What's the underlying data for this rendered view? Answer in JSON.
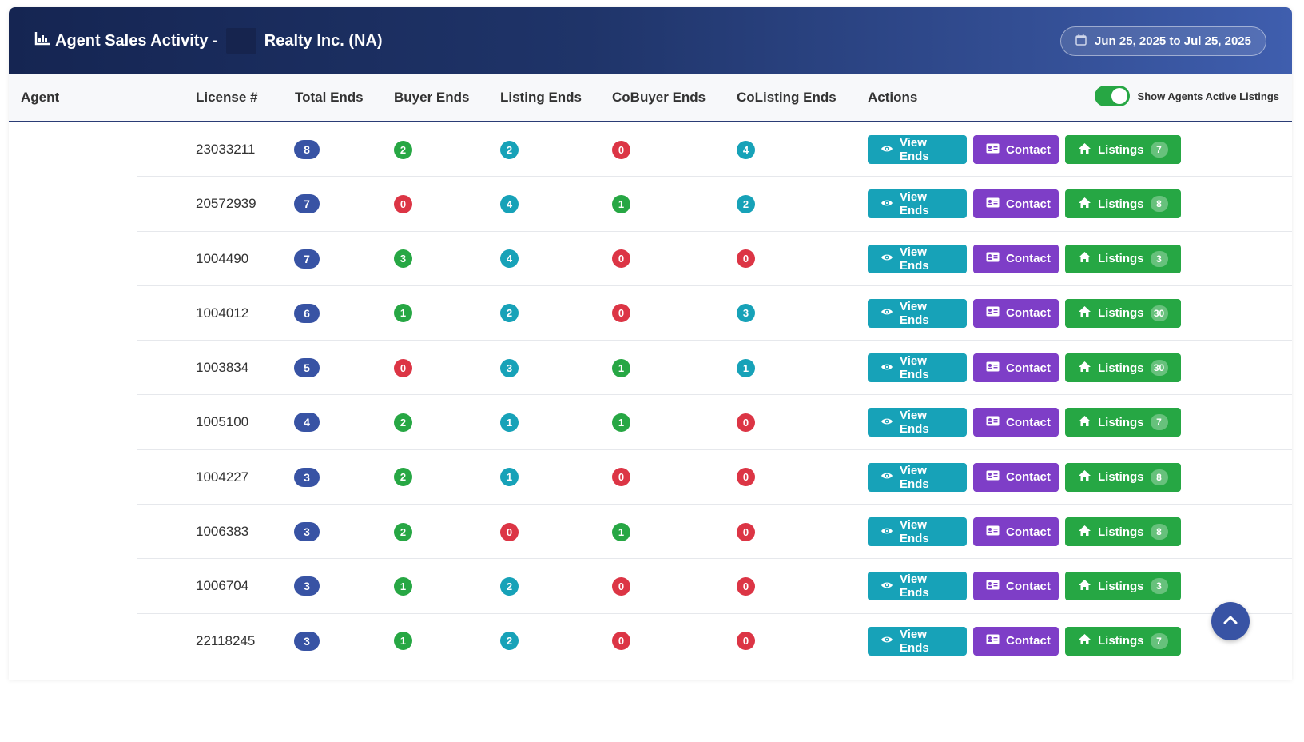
{
  "header": {
    "title_prefix": "Agent Sales Activity -",
    "title_suffix": "Realty Inc. (NA)",
    "date_range": "Jun 25, 2025 to Jul 25, 2025"
  },
  "columns": {
    "agent": "Agent",
    "license": "License #",
    "total": "Total Ends",
    "buyer": "Buyer Ends",
    "listing": "Listing Ends",
    "cobuyer": "CoBuyer Ends",
    "colisting": "CoListing Ends",
    "actions": "Actions"
  },
  "toggle": {
    "label": "Show Agents Active Listings",
    "on": true
  },
  "buttons": {
    "view": "View Ends",
    "contact": "Contact",
    "listings": "Listings"
  },
  "colors": {
    "total": "#3853a4",
    "green": "#27a744",
    "teal": "#17a2b8",
    "red": "#dc3545",
    "purple": "#7e3ec7"
  },
  "rows": [
    {
      "license": "23033211",
      "total": "8",
      "buyer": "2",
      "listing": "2",
      "cobuyer": "0",
      "colisting": "4",
      "listings_count": "7"
    },
    {
      "license": "20572939",
      "total": "7",
      "buyer": "0",
      "listing": "4",
      "cobuyer": "1",
      "colisting": "2",
      "listings_count": "8"
    },
    {
      "license": "1004490",
      "total": "7",
      "buyer": "3",
      "listing": "4",
      "cobuyer": "0",
      "colisting": "0",
      "listings_count": "3"
    },
    {
      "license": "1004012",
      "total": "6",
      "buyer": "1",
      "listing": "2",
      "cobuyer": "0",
      "colisting": "3",
      "listings_count": "30"
    },
    {
      "license": "1003834",
      "total": "5",
      "buyer": "0",
      "listing": "3",
      "cobuyer": "1",
      "colisting": "1",
      "listings_count": "30"
    },
    {
      "license": "1005100",
      "total": "4",
      "buyer": "2",
      "listing": "1",
      "cobuyer": "1",
      "colisting": "0",
      "listings_count": "7"
    },
    {
      "license": "1004227",
      "total": "3",
      "buyer": "2",
      "listing": "1",
      "cobuyer": "0",
      "colisting": "0",
      "listings_count": "8"
    },
    {
      "license": "1006383",
      "total": "3",
      "buyer": "2",
      "listing": "0",
      "cobuyer": "1",
      "colisting": "0",
      "listings_count": "8"
    },
    {
      "license": "1006704",
      "total": "3",
      "buyer": "1",
      "listing": "2",
      "cobuyer": "0",
      "colisting": "0",
      "listings_count": "3"
    },
    {
      "license": "22118245",
      "total": "3",
      "buyer": "1",
      "listing": "2",
      "cobuyer": "0",
      "colisting": "0",
      "listings_count": "7"
    }
  ]
}
